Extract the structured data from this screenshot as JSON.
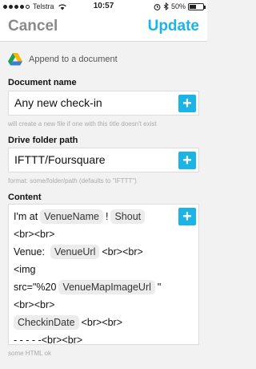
{
  "status_bar": {
    "carrier": "Telstra",
    "time": "10:57",
    "battery": "50%",
    "battery_level": 0.5,
    "signal_bars": 4
  },
  "nav": {
    "cancel_label": "Cancel",
    "update_label": "Update"
  },
  "action": {
    "label": "Append to a document",
    "icon": "google-drive-icon"
  },
  "document_name": {
    "label": "Document name",
    "value": "Any new check-in",
    "help": "will create a new file if one with this title doesn't exist"
  },
  "drive_folder": {
    "label": "Drive folder path",
    "value": "IFTTT/Foursquare",
    "help": "format: some/folder/path (defaults to \"IFTTT\")"
  },
  "content": {
    "label": "Content",
    "line1_text": "I'm at",
    "ingredient_venue_name": "VenueName",
    "line1_bang": "!",
    "ingredient_shout": "Shout",
    "line2": "<br><br>",
    "line3_text": "Venue:",
    "ingredient_venue_url": "VenueUrl",
    "line3_br": "<br><br>",
    "line4": "<img",
    "line5_text": "src=\"%20",
    "ingredient_venue_map": "VenueMapImageUrl",
    "line5_quote": "\"",
    "line6": "<br><br>",
    "ingredient_checkin_date": "CheckinDate",
    "line7_br": "<br><br>",
    "line8": "- - - - -<br><br>",
    "help": "some HTML ok"
  },
  "colors": {
    "accent": "#1cb4e6",
    "cancel": "#8a8a8a",
    "background": "#f2f2f2"
  }
}
